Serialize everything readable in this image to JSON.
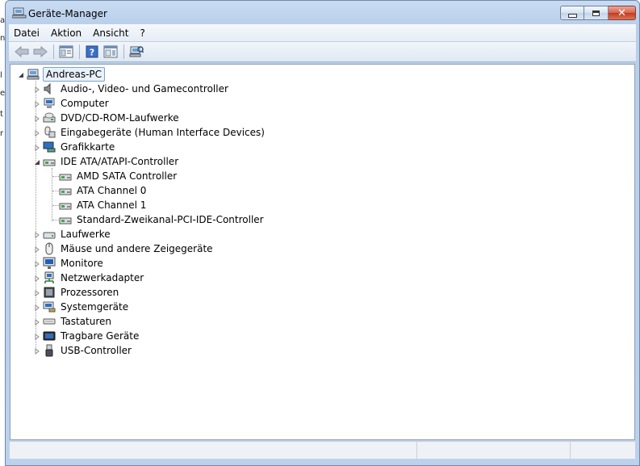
{
  "window": {
    "title": "Geräte-Manager"
  },
  "menu": {
    "items": [
      "Datei",
      "Aktion",
      "Ansicht",
      "?"
    ]
  },
  "toolbar": {
    "buttons": [
      "back-icon",
      "forward-icon",
      "properties-icon",
      "help-icon",
      "view-icon",
      "scan-hardware-icon"
    ]
  },
  "tree": {
    "root": "Andreas-PC",
    "categories": [
      {
        "label": "Audio-, Video- und Gamecontroller",
        "icon": "speaker-icon",
        "expanded": false
      },
      {
        "label": "Computer",
        "icon": "computer-icon",
        "expanded": false
      },
      {
        "label": "DVD/CD-ROM-Laufwerke",
        "icon": "dvd-drive-icon",
        "expanded": false
      },
      {
        "label": "Eingabegeräte (Human Interface Devices)",
        "icon": "hid-icon",
        "expanded": false
      },
      {
        "label": "Grafikkarte",
        "icon": "display-adapter-icon",
        "expanded": false
      },
      {
        "label": "IDE ATA/ATAPI-Controller",
        "icon": "ide-controller-icon",
        "expanded": true,
        "children": [
          "AMD SATA Controller",
          "ATA Channel 0",
          "ATA Channel 1",
          "Standard-Zweikanal-PCI-IDE-Controller"
        ]
      },
      {
        "label": "Laufwerke",
        "icon": "disk-drive-icon",
        "expanded": false
      },
      {
        "label": "Mäuse und andere Zeigegeräte",
        "icon": "mouse-icon",
        "expanded": false
      },
      {
        "label": "Monitore",
        "icon": "monitor-icon",
        "expanded": false
      },
      {
        "label": "Netzwerkadapter",
        "icon": "network-adapter-icon",
        "expanded": false
      },
      {
        "label": "Prozessoren",
        "icon": "processor-icon",
        "expanded": false
      },
      {
        "label": "Systemgeräte",
        "icon": "system-devices-icon",
        "expanded": false
      },
      {
        "label": "Tastaturen",
        "icon": "keyboard-icon",
        "expanded": false
      },
      {
        "label": "Tragbare Geräte",
        "icon": "portable-devices-icon",
        "expanded": false
      },
      {
        "label": "USB-Controller",
        "icon": "usb-icon",
        "expanded": false
      }
    ]
  },
  "colors": {
    "titlebar": "#c9dcf3",
    "close_button": "#c3391c",
    "selection_border": "#7da2ce"
  }
}
